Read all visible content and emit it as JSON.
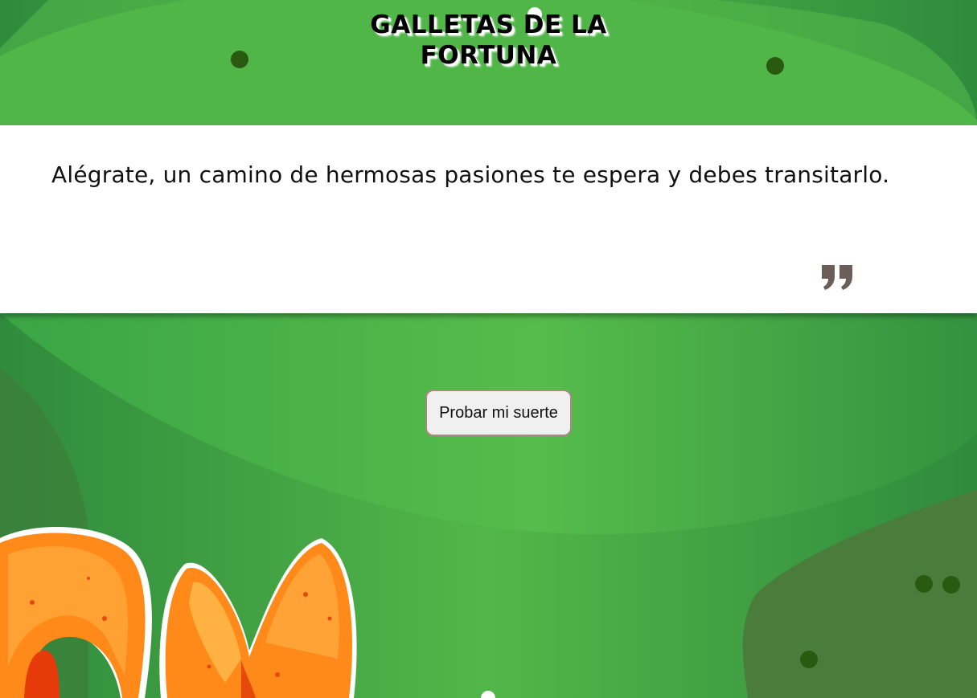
{
  "header": {
    "title_line1": "GALLETAS DE LA",
    "title_line2": "FORTUNA"
  },
  "fortune": {
    "message": "Alégrate, un camino de hermosas pasiones te espera y debes transitarlo.",
    "quote_icon": "closing-quote-icon"
  },
  "actions": {
    "try_luck_label": "Probar mi suerte"
  },
  "decorations": {
    "cookie_icon": "fortune-cookie-illustration"
  },
  "colors": {
    "background_green": "#3a9a44",
    "light_green": "#55bb4a",
    "dark_dot": "#2a5a10",
    "cookie_orange": "#ff8a1a",
    "quote_gray": "#6b5d5a"
  }
}
